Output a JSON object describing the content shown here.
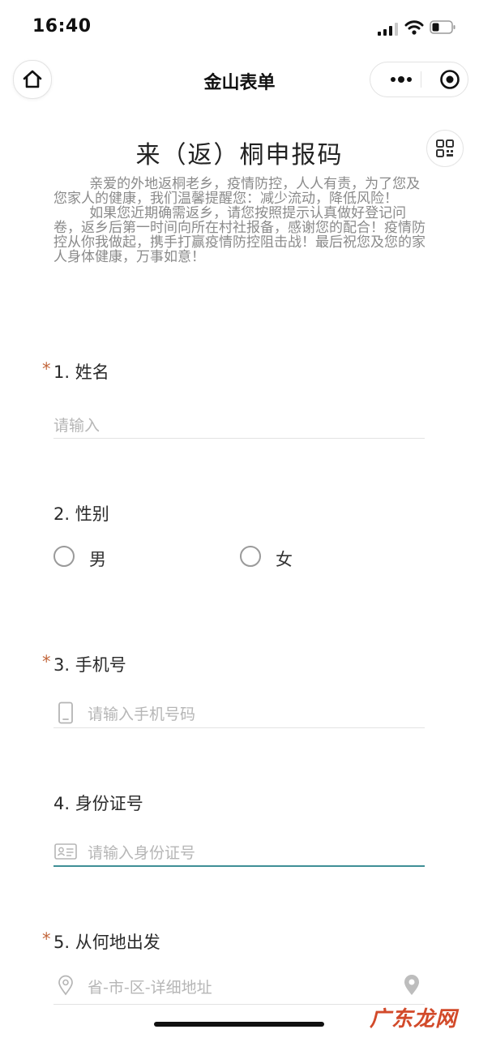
{
  "status_bar": {
    "time": "16:40"
  },
  "nav": {
    "title": "金山表单"
  },
  "form": {
    "title": "来（返）桐申报码",
    "intro_p1": "亲爱的外地返桐老乡，疫情防控，人人有责，为了您及您家人的健康，我们温馨提醒您：减少流动，降低风险！",
    "intro_p2": "如果您近期确需返乡，请您按照提示认真做好登记问卷，返乡后第一时间向所在村社报备，感谢您的配合！疫情防控从你我做起，携手打赢疫情防控阻击战！最后祝您及您的家人身体健康，万事如意！"
  },
  "questions": [
    {
      "number": "1.",
      "label": "姓名",
      "required": "*",
      "placeholder": "请输入"
    },
    {
      "number": "2.",
      "label": "性别",
      "options": [
        "男",
        "女"
      ]
    },
    {
      "number": "3.",
      "label": "手机号",
      "required": "*",
      "placeholder": "请输入手机号码"
    },
    {
      "number": "4.",
      "label": "身份证号",
      "placeholder": "请输入身份证号"
    },
    {
      "number": "5.",
      "label": "从何地出发",
      "required": "*",
      "placeholder": "省-市-区-详细地址"
    }
  ],
  "watermark": "广东龙网",
  "icons": {
    "home": "home-icon",
    "more": "more-dots-icon",
    "close": "close-circle-icon",
    "qr": "qr-code-icon",
    "phone": "phone-icon",
    "id_card": "id-card-icon",
    "location": "location-pin-icon"
  },
  "colors": {
    "required_star": "#c2663b",
    "active_underline": "#3f8f96",
    "placeholder": "#b6b6b6"
  }
}
